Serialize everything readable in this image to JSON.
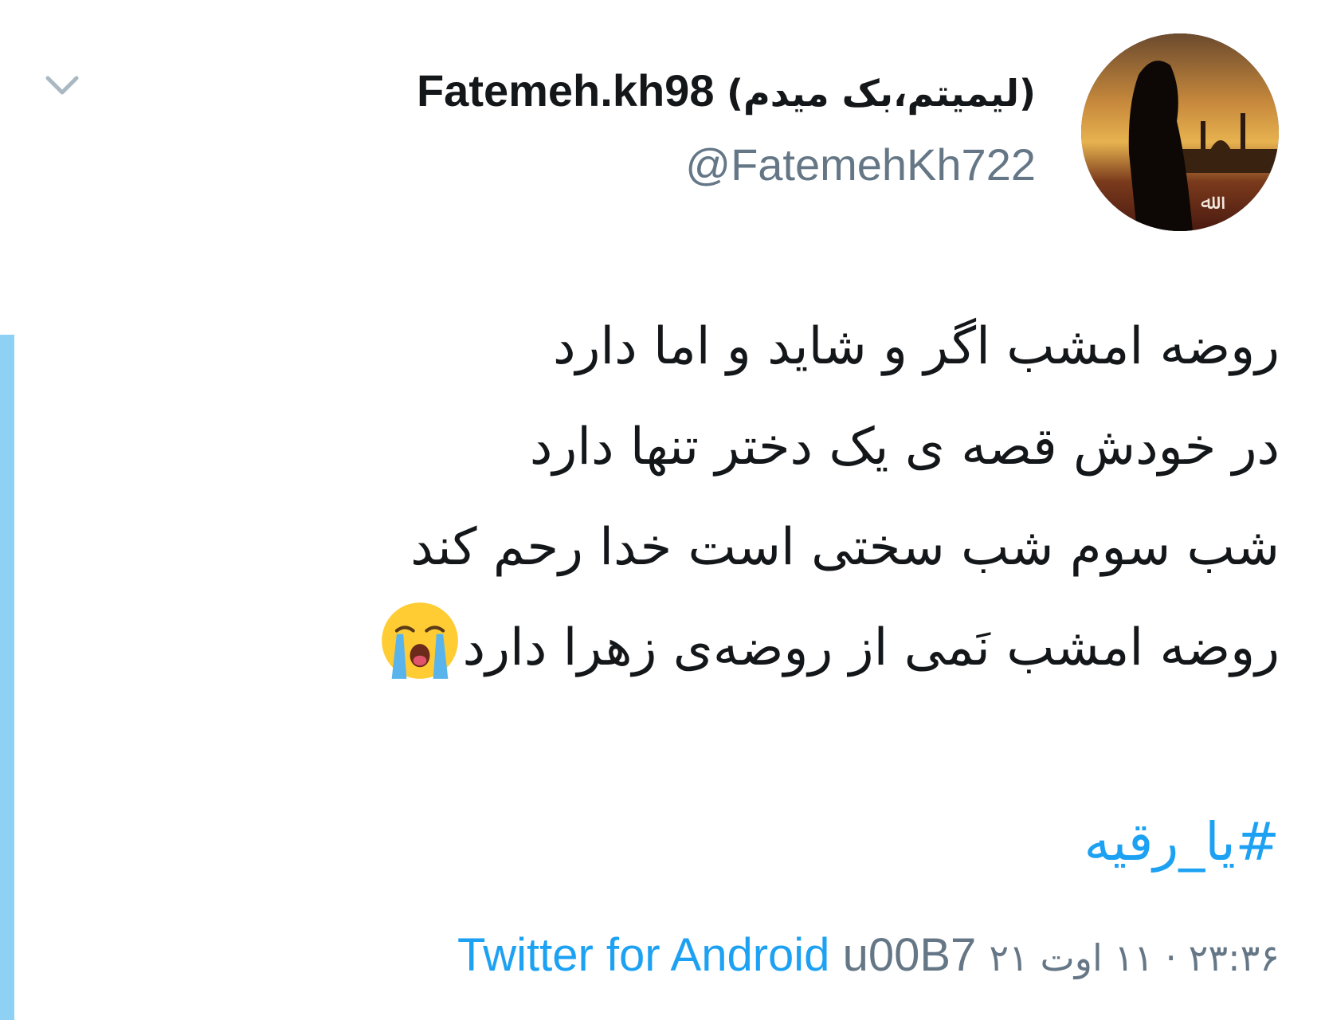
{
  "user": {
    "display_name_latin": "Fatemeh.kh98",
    "display_name_persian": "(لیمیتم،بک میدم)",
    "handle": "@FatemehKh722"
  },
  "tweet": {
    "lines": [
      "روضه امشب اگر و شاید و اما دارد",
      "در خودش قصه ی یک دختر تنها دارد",
      "شب سوم شب سختی است خدا رحم کند",
      "روضه امشب نَمی از روضه‌ی زهرا دارد"
    ],
    "emoji": "crying-face",
    "hashtag": "#یا_رقیه"
  },
  "meta": {
    "timestamp": "۲۳:۳۶ · ۱۱ اوت ۲۱",
    "separator": "u00B7",
    "source": "Twitter for Android"
  },
  "colors": {
    "link": "#1da1f2",
    "muted": "#657786",
    "text": "#14171a",
    "thread_line": "#8fd0f5"
  },
  "icons": {
    "menu": "chevron-down-icon",
    "emoji": "loudly-crying-face-emoji"
  }
}
